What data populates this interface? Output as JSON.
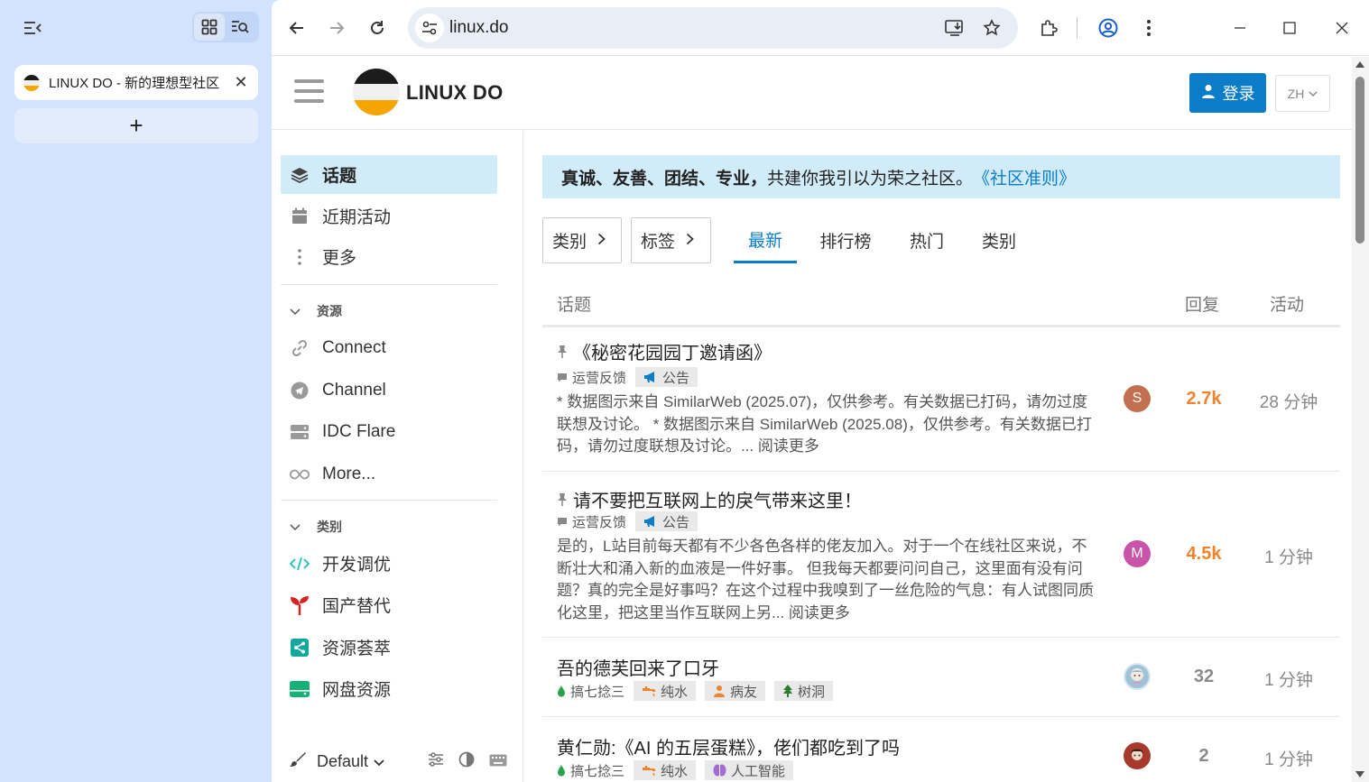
{
  "vertical_tabs": {
    "tabs": [
      {
        "title": "LINUX DO - 新的理想型社区"
      }
    ],
    "new_tab_label": "+"
  },
  "toolbar": {
    "url": "linux.do"
  },
  "site": {
    "brand": "LINUX DO",
    "login_label": "登录",
    "lang_label": "ZH"
  },
  "sidebar": {
    "items": [
      {
        "label": "话题",
        "icon": "layers-icon"
      },
      {
        "label": "近期活动",
        "icon": "calendar-icon"
      },
      {
        "label": "更多",
        "icon": "vertical-dots-icon"
      }
    ],
    "sections": [
      {
        "title": "资源",
        "items": [
          {
            "label": "Connect",
            "icon": "link-icon"
          },
          {
            "label": "Channel",
            "icon": "telegram-icon"
          },
          {
            "label": "IDC Flare",
            "icon": "server-icon"
          },
          {
            "label": "More...",
            "icon": "infinity-icon"
          }
        ]
      },
      {
        "title": "类别",
        "items": [
          {
            "label": "开发调优",
            "icon": "code-icon",
            "color": "#32c3c3"
          },
          {
            "label": "国产替代",
            "icon": "seedling-icon",
            "color": "#d7221f"
          },
          {
            "label": "资源荟萃",
            "icon": "share-icon",
            "color": "#12a89d"
          },
          {
            "label": "网盘资源",
            "icon": "hard-drive-icon",
            "color": "#16b176"
          }
        ]
      }
    ],
    "footer": {
      "theme": "Default"
    }
  },
  "main": {
    "notice": {
      "bold_text": "真诚、友善、团结、专业，",
      "text": "共建你我引以为荣之社区。",
      "link_text": "《社区准则》"
    },
    "filters": [
      {
        "label": "类别"
      },
      {
        "label": "标签"
      }
    ],
    "tabs": [
      {
        "label": "最新",
        "active": true
      },
      {
        "label": "排行榜",
        "active": false
      },
      {
        "label": "热门",
        "active": false
      },
      {
        "label": "类别",
        "active": false
      }
    ],
    "columns": {
      "topic": "话题",
      "replies": "回复",
      "activity": "活动"
    },
    "topics": [
      {
        "title": "《秘密花园园丁邀请函》",
        "pinned": true,
        "category": "运营反馈",
        "tags": [
          "公告"
        ],
        "excerpt": "* 数据图示来自 SimilarWeb (2025.07)，仅供参考。有关数据已打码，请勿过度联想及讨论。 * 数据图示来自 SimilarWeb (2025.08)，仅供参考。有关数据已打码，请勿过度联想及讨论。",
        "read_more": "... 阅读更多",
        "avatar_letter": "S",
        "avatar_color": "#c2704f",
        "replies": "2.7k",
        "replies_color": "#f0832b",
        "activity": "28 分钟"
      },
      {
        "title": "请不要把互联网上的戾气带来这里！",
        "pinned": true,
        "category": "运营反馈",
        "tags": [
          "公告"
        ],
        "excerpt": "是的，L站目前每天都有不少各色各样的佬友加入。对于一个在线社区来说，不断壮大和涌入新的血液是一件好事。 但我每天都要问问自己，这里面有没有问题？真的完全是好事吗？在这个过程中我嗅到了一丝危险的气息：有人试图同质化这里，把这里当作互联网上另...",
        "read_more": " 阅读更多",
        "avatar_letter": "M",
        "avatar_color": "#c853a8",
        "replies": "4.5k",
        "replies_color": "#f0832b",
        "activity": "1 分钟"
      },
      {
        "title": "吾的德芙回来了口牙",
        "pinned": false,
        "category": "搞七捻三",
        "tags": [
          "纯水",
          "病友",
          "树洞"
        ],
        "excerpt": "",
        "read_more": "",
        "avatar_letter": "",
        "avatar_color": "#9fc3d8",
        "replies": "32",
        "replies_color": "#8a8a8a",
        "activity": "1 分钟"
      },
      {
        "title": "黄仁勋:《AI 的五层蛋糕》，佬们都吃到了吗",
        "pinned": false,
        "category": "搞七捻三",
        "tags": [
          "纯水",
          "人工智能"
        ],
        "excerpt": "",
        "read_more": "",
        "avatar_letter": "",
        "avatar_color": "#a83a2d",
        "replies": "2",
        "replies_color": "#8a8a8a",
        "activity": "1 分钟"
      }
    ]
  }
}
